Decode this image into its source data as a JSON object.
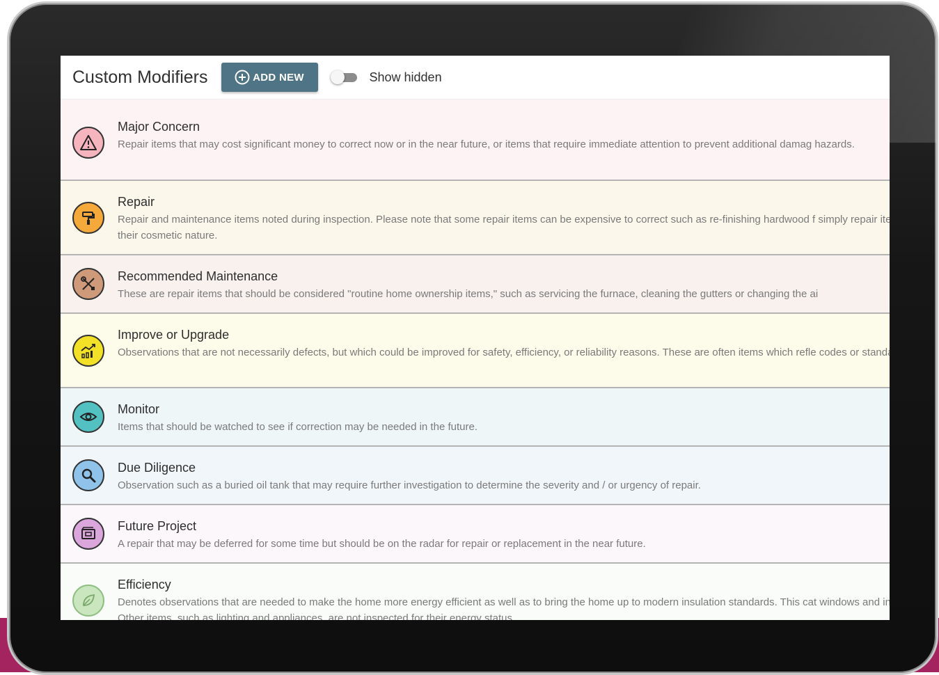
{
  "header": {
    "title": "Custom Modifiers",
    "add_button_label": "ADD NEW",
    "show_hidden_label": "Show hidden"
  },
  "modifiers": [
    {
      "name": "Major Concern",
      "description": "Repair items that may cost significant money to correct now or in the near future, or items that require immediate attention to prevent additional damag hazards.",
      "icon": "warning-icon",
      "color": "#f6b4be",
      "bg": "#fdf3f4"
    },
    {
      "name": "Repair",
      "description": "Repair and maintenance items noted during inspection. Please note that some repair items can be expensive to correct such as re-finishing hardwood f simply repair items due to their cosmetic nature.",
      "icon": "paint-roller-icon",
      "color": "#f5a93b",
      "bg": "#fcf7eb"
    },
    {
      "name": "Recommended Maintenance",
      "description": "These are repair items that should be considered \"routine home ownership items,\" such as servicing the furnace, cleaning the gutters or changing the ai",
      "icon": "tools-icon",
      "color": "#cf9a7a",
      "bg": "#f8f1ee"
    },
    {
      "name": "Improve or Upgrade",
      "description": "Observations that are not necessarily defects, but which could be improved for safety, efficiency, or reliability reasons. These are often items which refle codes or standards.",
      "icon": "chart-growth-icon",
      "color": "#f3e128",
      "bg": "#fdfbea"
    },
    {
      "name": "Monitor",
      "description": "Items that should be watched to see if correction may be needed in the future.",
      "icon": "eye-icon",
      "color": "#53c1c1",
      "bg": "#eef6f7"
    },
    {
      "name": "Due Diligence",
      "description": "Observation such as a buried oil tank that may require further investigation to determine the severity and / or urgency of repair.",
      "icon": "magnifier-icon",
      "color": "#8fc3ea",
      "bg": "#f1f6fb"
    },
    {
      "name": "Future Project",
      "description": "A repair that may be deferred for some time but should be on the radar for repair or replacement in the near future.",
      "icon": "wallet-icon",
      "color": "#dba6dc",
      "bg": "#fbf7fb"
    },
    {
      "name": "Efficiency",
      "description": "Denotes observations that are needed to make the home more energy efficient as well as to bring the home up to modern insulation standards. This cat windows and insulation. Other items, such as lighting and appliances, are not inspected for their energy status.",
      "icon": "leaf-icon",
      "color": "#c9e6bf",
      "bg": "#f9fcf8"
    }
  ]
}
